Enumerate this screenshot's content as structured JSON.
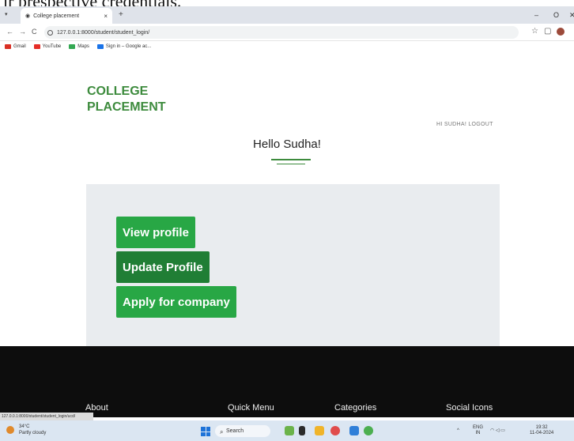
{
  "caption": "ir prespective credentials.",
  "browser": {
    "tab_title": "College placement",
    "tab_close": "×",
    "new_tab": "+",
    "url": "127.0.0.1:8000/student/student_login/",
    "win_minimize": "–",
    "win_maximize": "O",
    "win_close": "✕",
    "bookmarks": [
      {
        "label": "Gmail",
        "color": "#d93025"
      },
      {
        "label": "YouTube",
        "color": "#e52d27"
      },
      {
        "label": "Maps",
        "color": "#34a853"
      },
      {
        "label": "Sign in – Google ac...",
        "color": "#1a73e8"
      }
    ],
    "status_url": "127.0.0.1:8000/student/student_login/ucd/"
  },
  "page": {
    "logo_line1": "COLLEGE",
    "logo_line2": "PLACEMENT",
    "logout": "HI SUDHA! LOGOUT",
    "greeting": "Hello Sudha!",
    "buttons": {
      "view_profile": "View profile",
      "update_profile": "Update Profile",
      "apply_company": "Apply for company"
    },
    "accent_color": "#28a745"
  },
  "footer": {
    "about": "About",
    "quick_menu": "Quick Menu",
    "categories": "Categories",
    "social_icons": "Social Icons"
  },
  "taskbar": {
    "weather_temp": "34°C",
    "weather_desc": "Partly cloudy",
    "search_label": "Search",
    "lang_line1": "ENG",
    "lang_line2": "IN",
    "time": "19:32",
    "date": "11-04-2024"
  }
}
